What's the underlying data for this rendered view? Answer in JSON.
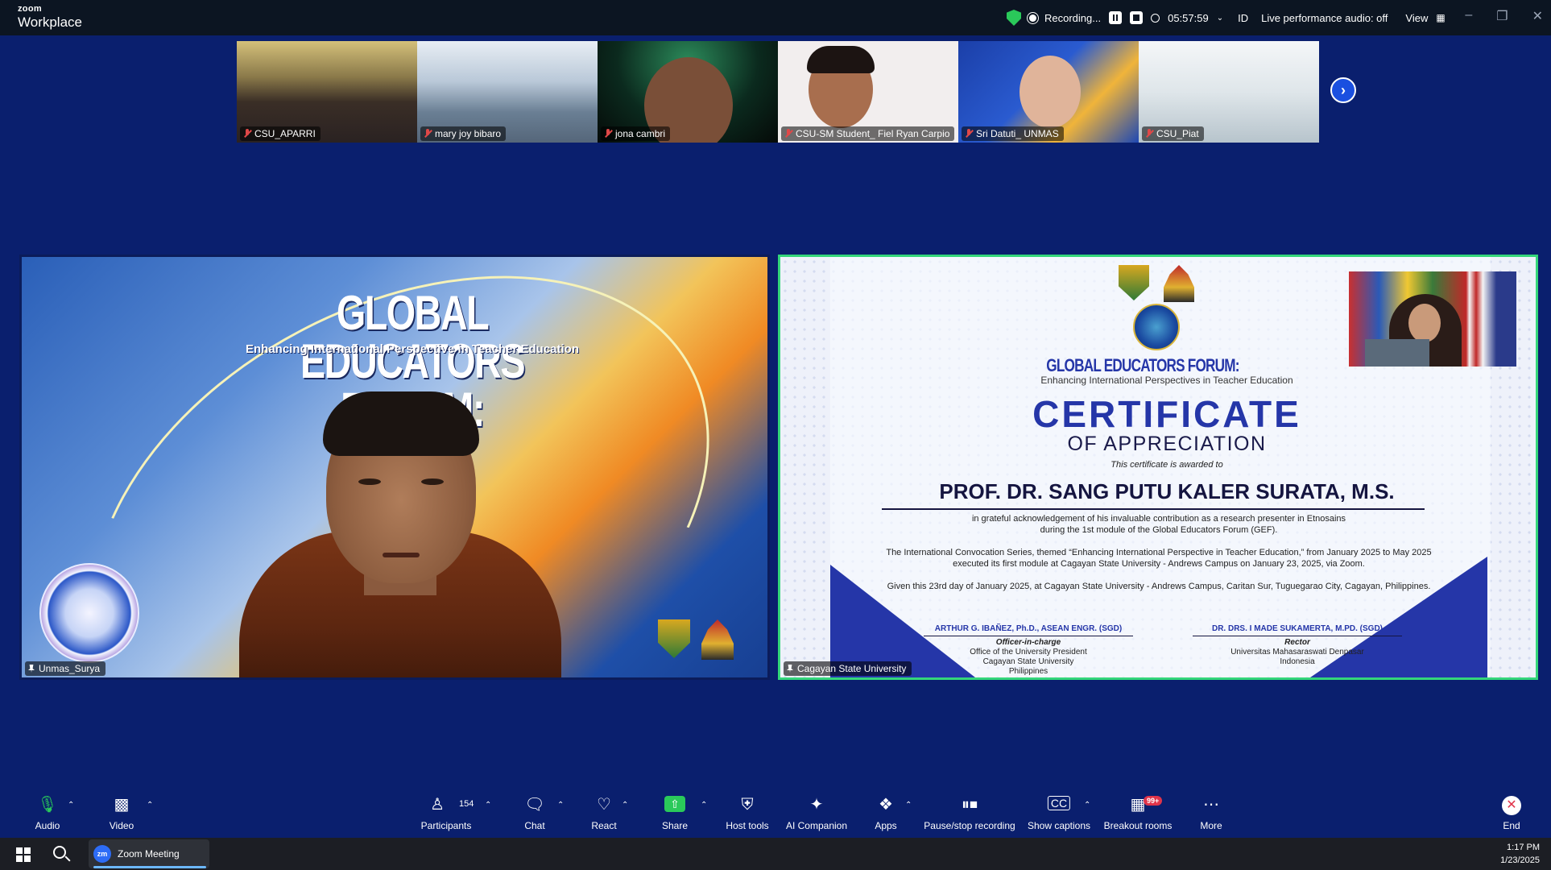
{
  "app": {
    "brand_small": "zoom",
    "brand_name": "Workplace"
  },
  "titlebar": {
    "recording_label": "Recording...",
    "elapsed_time": "05:57:59",
    "id_label": "ID",
    "live_audio_label": "Live performance audio: off",
    "view_label": "View"
  },
  "gallery": {
    "participants": [
      {
        "name": "CSU_APARRI",
        "muted": true
      },
      {
        "name": "mary joy bibaro",
        "muted": true
      },
      {
        "name": "jona cambri",
        "muted": true
      },
      {
        "name": "CSU-SM Student_ Fiel Ryan Carpio",
        "muted": true
      },
      {
        "name": "Sri Datuti_ UNMAS",
        "muted": true
      },
      {
        "name": "CSU_Piat",
        "muted": true
      }
    ]
  },
  "main": {
    "left_panel": {
      "name": "Unmas_Surya",
      "background_title": "GLOBAL EDUCATORS FORUM:",
      "background_subtitle": "Enhancing International Perspective in Teacher Education"
    },
    "right_panel": {
      "name": "Cagayan State University",
      "certificate": {
        "forum_title": "GLOBAL EDUCATORS FORUM:",
        "forum_subtitle": "Enhancing International Perspectives in Teacher Education",
        "title": "CERTIFICATE",
        "subtitle": "OF APPRECIATION",
        "awarded_to": "This certificate is awarded to",
        "recipient": "PROF. DR. SANG PUTU KALER SURATA, M.S.",
        "line1": "in grateful acknowledgement of his invaluable contribution as a research presenter in Etnosains",
        "line2": "during the 1st module of the Global Educators Forum (GEF).",
        "line3": "The International Convocation Series, themed “Enhancing International Perspective in Teacher Education,” from January 2025 to May 2025",
        "line4": "executed its first module at Cagayan State University - Andrews Campus on January 23, 2025, via Zoom.",
        "line5": "Given this 23rd day of January 2025, at Cagayan State University - Andrews Campus, Caritan Sur, Tuguegarao City, Cagayan, Philippines.",
        "signatory_left": {
          "name": "ARTHUR G. IBAÑEZ, Ph.D., ASEAN ENGR. (SGD)",
          "role": "Officer-in-charge",
          "org1": "Office of the University President",
          "org2": "Cagayan State University",
          "org3": "Philippines"
        },
        "signatory_right": {
          "name": "DR. DRS. I MADE SUKAMERTA, M.PD. (SGD)",
          "role": "Rector",
          "org1": "Universitas Mahasaraswati Denpasar",
          "org2": "Indonesia"
        }
      }
    }
  },
  "toolbar": {
    "audio": "Audio",
    "video": "Video",
    "participants": "Participants",
    "participants_count": "154",
    "chat": "Chat",
    "react": "React",
    "share": "Share",
    "host_tools": "Host tools",
    "ai_companion": "AI Companion",
    "apps": "Apps",
    "pause_stop_recording": "Pause/stop recording",
    "show_captions": "Show captions",
    "breakout_rooms": "Breakout rooms",
    "breakout_badge": "99+",
    "more": "More",
    "end": "End"
  },
  "taskbar": {
    "app_label": "Zoom Meeting",
    "app_icon_text": "zm",
    "time": "1:17 PM",
    "date": "1/23/2025"
  },
  "colors": {
    "background": "#0a1f6e",
    "active_speaker_border": "#34d67a",
    "share_green": "#2ac95a",
    "end_red": "#e0344a"
  }
}
